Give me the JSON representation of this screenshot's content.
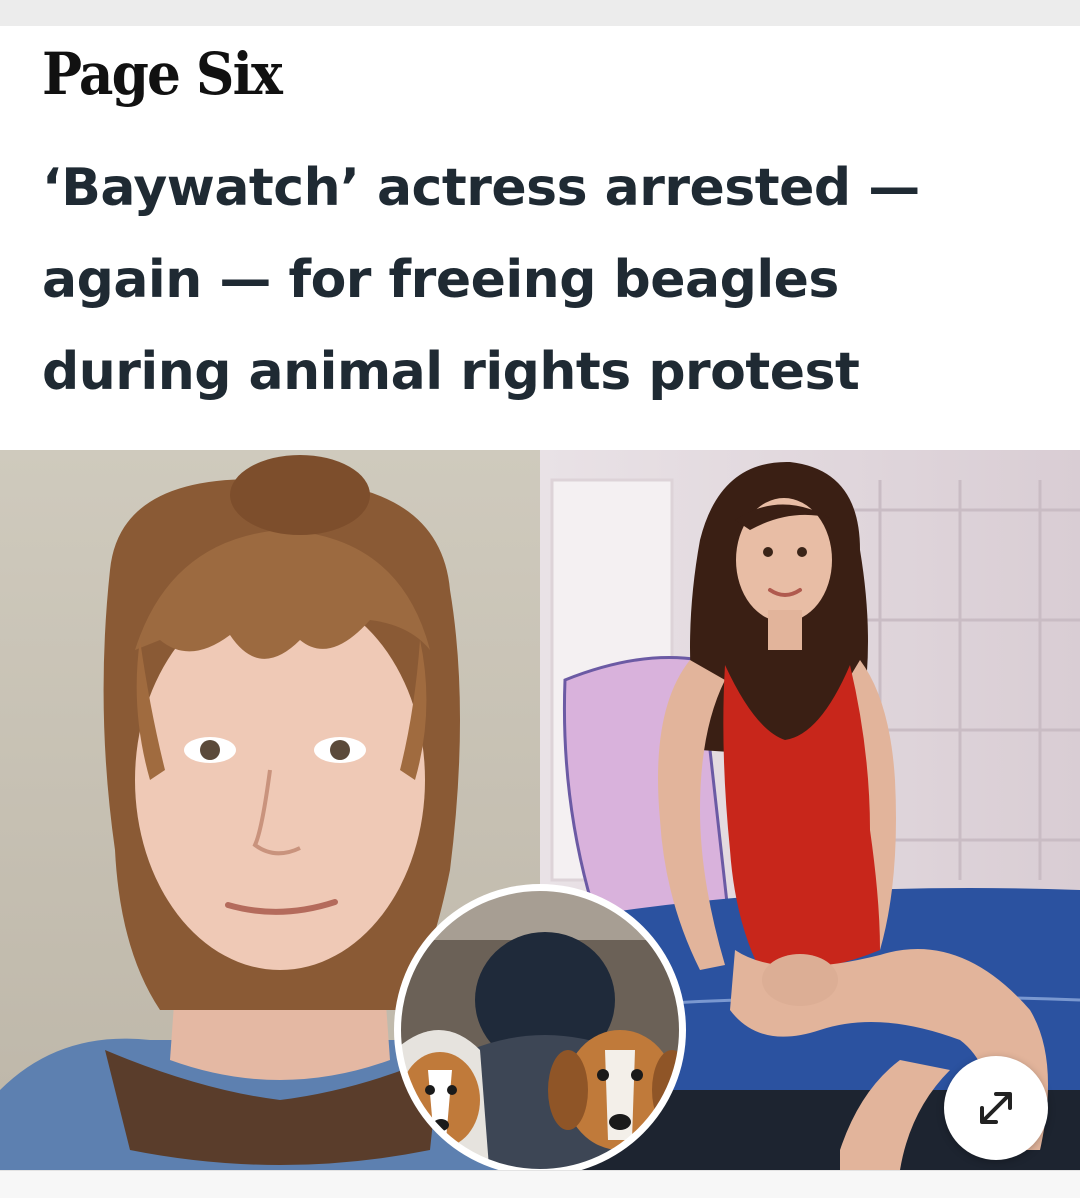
{
  "header": {
    "brand": "Page Six"
  },
  "article": {
    "headline": "‘Baywatch’ actress arrested — again — for freeing beagles during animal rights protest"
  },
  "media": {
    "left_photo": "mugshot-photo",
    "right_photo": "red-swimsuit-photo",
    "inset_photo": "beagles-inset-photo",
    "expand_icon": "expand-icon"
  },
  "colors": {
    "headline_text": "#1f2a33",
    "brand_text": "#111111",
    "swimsuit_red": "#c8261b",
    "bench_blue": "#2b52a0"
  }
}
